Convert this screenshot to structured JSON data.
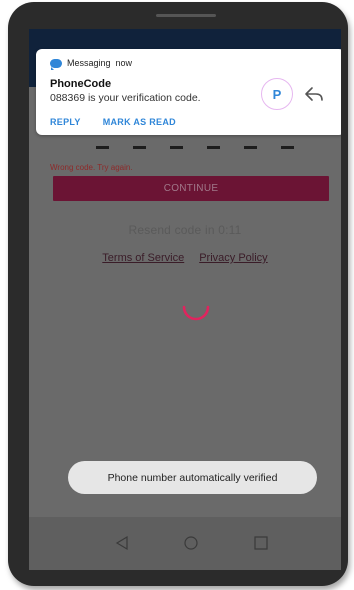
{
  "notification": {
    "app_name": "Messaging",
    "time": "now",
    "title": "PhoneCode",
    "body": "088369 is your verification code.",
    "avatar_letter": "P",
    "actions": [
      "REPLY",
      "MARK AS READ"
    ]
  },
  "verification": {
    "error_text": "Wrong code. Try again.",
    "continue_label": "CONTINUE",
    "resend_text": "Resend code in 0:11",
    "terms_label": "Terms of Service",
    "privacy_label": "Privacy Policy"
  },
  "toast": {
    "text": "Phone number automatically verified"
  },
  "navigation": {
    "icons": [
      "back-icon",
      "home-icon",
      "recents-icon"
    ]
  },
  "colors": {
    "notification_accent": "#2f86d8",
    "continue_button": "#6b1434",
    "spinner": "#e0245e",
    "error_text": "#8e2a2a"
  }
}
